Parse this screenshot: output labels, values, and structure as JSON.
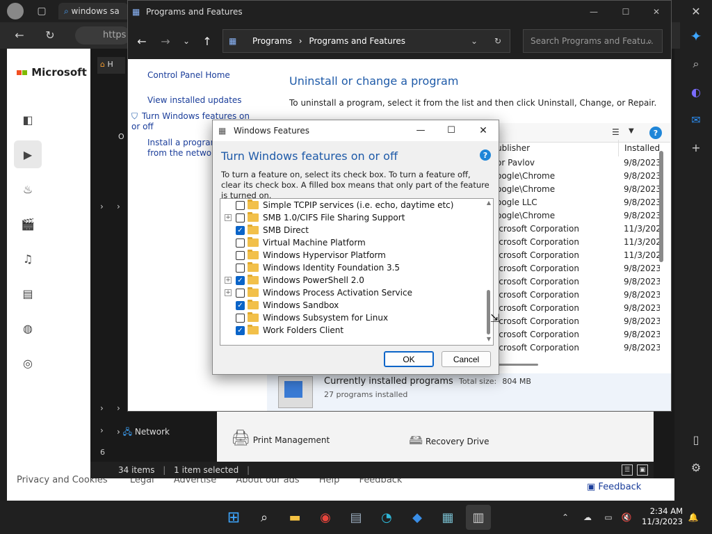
{
  "browser": {
    "tab_title": "windows sa",
    "url_partial": "https",
    "bing_logo": "Microsoft Bin",
    "footer": [
      "Privacy and Cookies",
      "Legal",
      "Advertise",
      "About our ads",
      "Help",
      "Feedback"
    ],
    "feedback": "Feedback"
  },
  "explorer": {
    "status_items": "34 items",
    "status_selected": "1 item selected",
    "network": "Network",
    "print_management": "Print Management",
    "recovery_drive": "Recovery Drive",
    "side_char_h": "H",
    "side_char_o": "O",
    "side_num": "6"
  },
  "control_panel": {
    "title": "Programs and Features",
    "breadcrumb_parent": "Programs",
    "breadcrumb_current": "Programs and Features",
    "search_placeholder": "Search Programs and Featu...",
    "links": {
      "home": "Control Panel Home",
      "updates": "View installed updates",
      "features": "Turn Windows features on or off",
      "install_net": "Install a program from the network"
    },
    "heading": "Uninstall or change a program",
    "subheading": "To uninstall a program, select it from the list and then click Uninstall, Change, or Repair.",
    "col_publisher": "ublisher",
    "col_installed": "Installed (",
    "rows": [
      {
        "publisher": "or Pavlov",
        "date": "9/8/2023"
      },
      {
        "publisher": "oogle\\Chrome",
        "date": "9/8/2023"
      },
      {
        "publisher": "oogle\\Chrome",
        "date": "9/8/2023"
      },
      {
        "publisher": "oogle LLC",
        "date": "9/8/2023"
      },
      {
        "publisher": "oogle\\Chrome",
        "date": "9/8/2023"
      },
      {
        "publisher": "icrosoft Corporation",
        "date": "11/3/2023"
      },
      {
        "publisher": "icrosoft Corporation",
        "date": "11/3/2023"
      },
      {
        "publisher": "icrosoft Corporation",
        "date": "11/3/2023"
      },
      {
        "publisher": "icrosoft Corporation",
        "date": "9/8/2023"
      },
      {
        "publisher": "icrosoft Corporation",
        "date": "9/8/2023"
      },
      {
        "publisher": "icrosoft Corporation",
        "date": "9/8/2023"
      },
      {
        "publisher": "icrosoft Corporation",
        "date": "9/8/2023"
      },
      {
        "publisher": "icrosoft Corporation",
        "date": "9/8/2023"
      },
      {
        "publisher": "icrosoft Corporation",
        "date": "9/8/2023"
      },
      {
        "publisher": "icrosoft Corporation",
        "date": "9/8/2023"
      }
    ],
    "footer_title": "Currently installed programs",
    "footer_size_label": "Total size:",
    "footer_size": "804 MB",
    "footer_count": "27 programs installed"
  },
  "dialog": {
    "title": "Windows Features",
    "heading": "Turn Windows features on or off",
    "description": "To turn a feature on, select its check box. To turn a feature off, clear its check box. A filled box means that only part of the feature is turned on.",
    "features": [
      {
        "label": "Simple TCPIP services (i.e. echo, daytime etc)",
        "expand": false,
        "checked": false
      },
      {
        "label": "SMB 1.0/CIFS File Sharing Support",
        "expand": true,
        "checked": false
      },
      {
        "label": "SMB Direct",
        "expand": false,
        "checked": true
      },
      {
        "label": "Virtual Machine Platform",
        "expand": false,
        "checked": false
      },
      {
        "label": "Windows Hypervisor Platform",
        "expand": false,
        "checked": false
      },
      {
        "label": "Windows Identity Foundation 3.5",
        "expand": false,
        "checked": false
      },
      {
        "label": "Windows PowerShell 2.0",
        "expand": true,
        "checked": true
      },
      {
        "label": "Windows Process Activation Service",
        "expand": true,
        "checked": false
      },
      {
        "label": "Windows Sandbox",
        "expand": false,
        "checked": true
      },
      {
        "label": "Windows Subsystem for Linux",
        "expand": false,
        "checked": false
      },
      {
        "label": "Work Folders Client",
        "expand": false,
        "checked": true
      }
    ],
    "ok": "OK",
    "cancel": "Cancel"
  },
  "taskbar": {
    "time": "2:34 AM",
    "date": "11/3/2023"
  },
  "colors": {
    "accent": "#0a64c8",
    "link": "#1a3d9a",
    "heading": "#1e5aa8"
  }
}
